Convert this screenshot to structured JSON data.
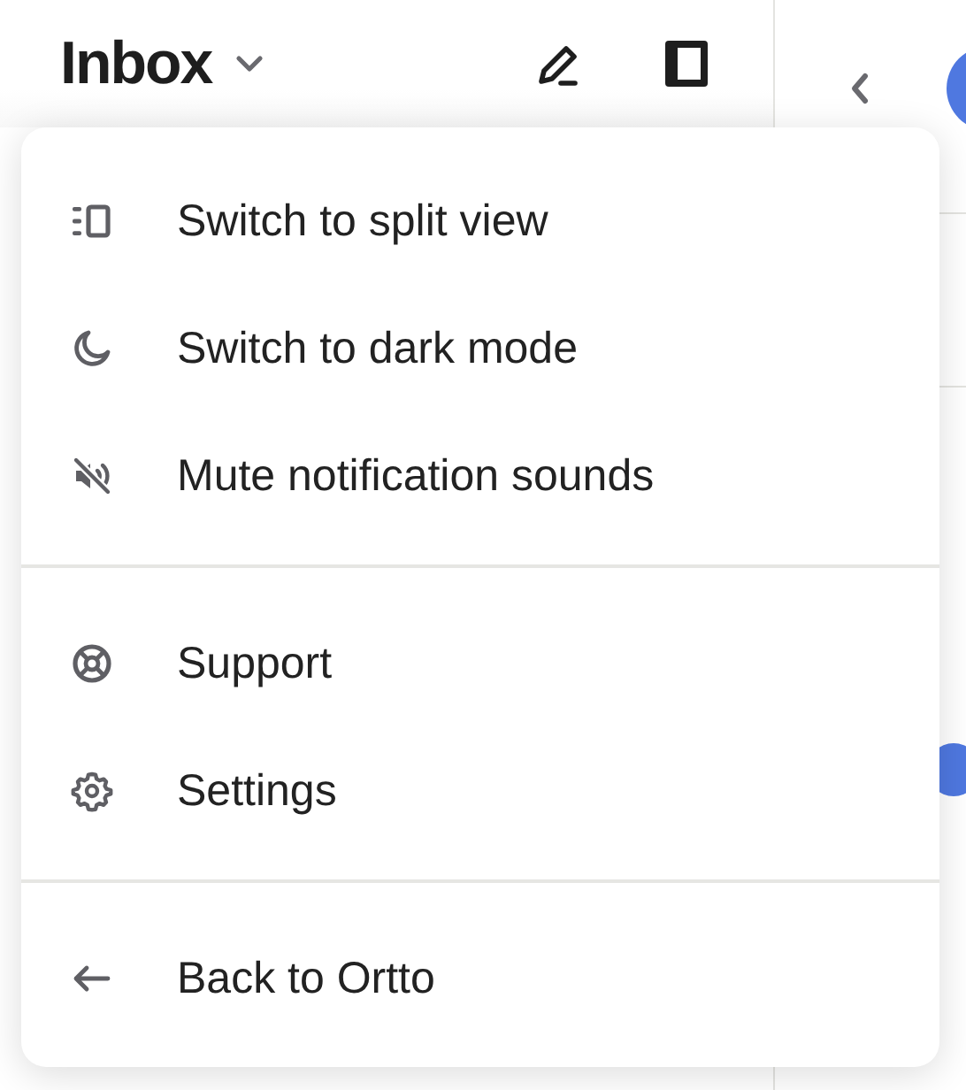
{
  "header": {
    "title": "Inbox"
  },
  "menu": {
    "sections": [
      {
        "items": [
          {
            "kind": "split",
            "label": "Switch to split view"
          },
          {
            "kind": "moon",
            "label": "Switch to dark mode"
          },
          {
            "kind": "mute",
            "label": "Mute notification sounds"
          }
        ]
      },
      {
        "items": [
          {
            "kind": "lifebuoy",
            "label": "Support"
          },
          {
            "kind": "gear",
            "label": "Settings"
          }
        ]
      },
      {
        "items": [
          {
            "kind": "back",
            "label": "Back to Ortto"
          }
        ]
      }
    ]
  }
}
